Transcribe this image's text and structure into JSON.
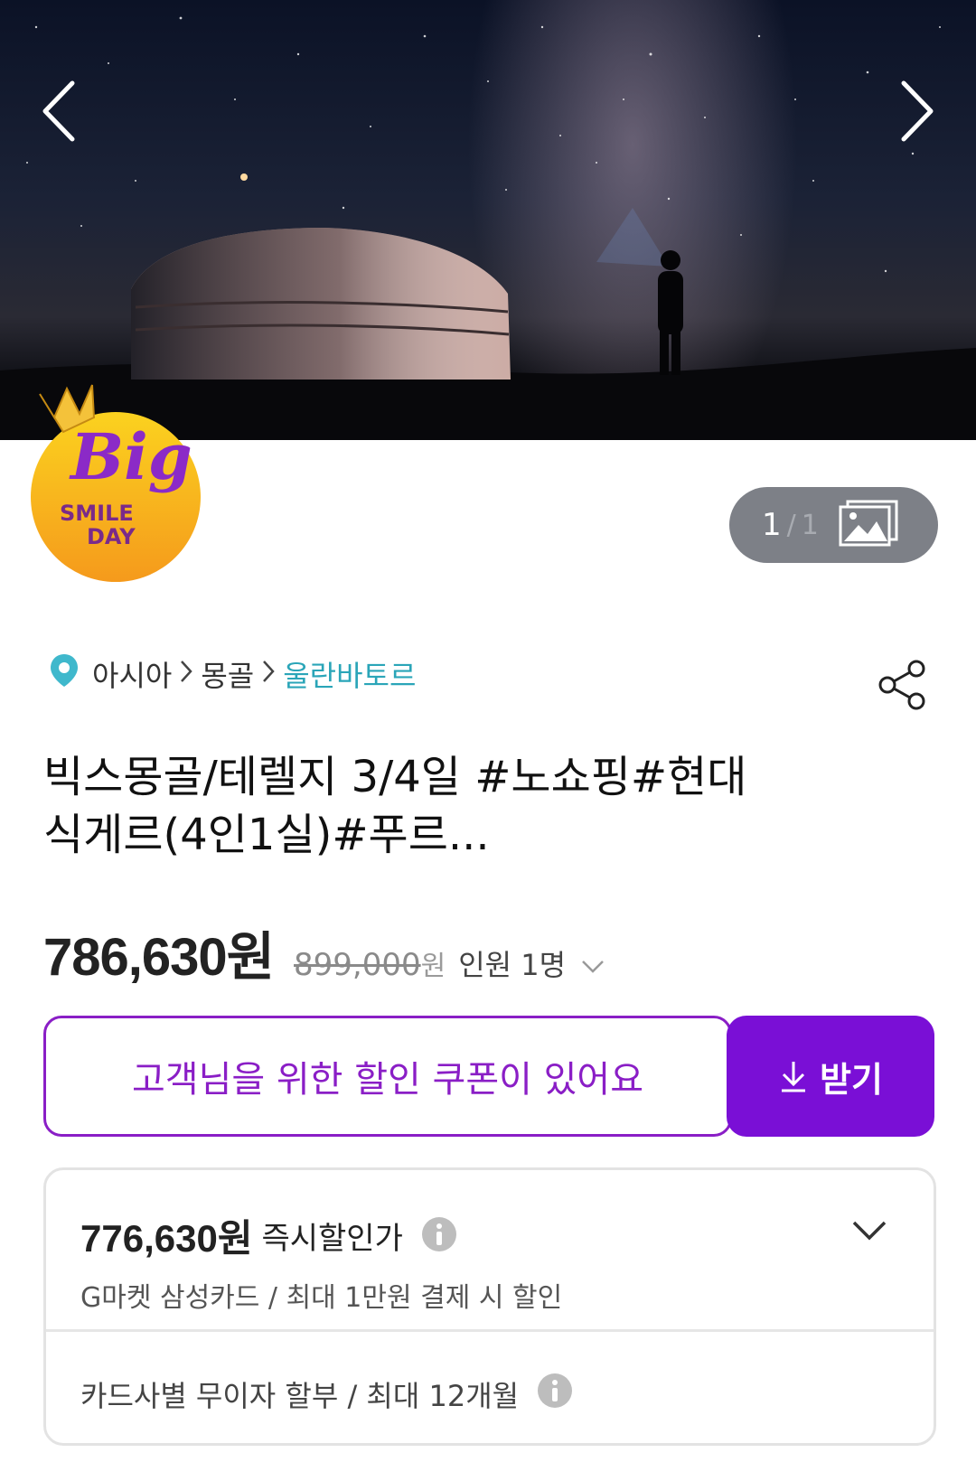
{
  "hero": {
    "image_description_name": "mongolia-ger-night-sky",
    "counter": {
      "current": "1",
      "separator": "/",
      "total": "1"
    }
  },
  "badge": {
    "line1": "Big",
    "line2": "SMILE",
    "line3": "DAY"
  },
  "breadcrumb": {
    "level1": "아시아",
    "level2": "몽골",
    "level3": "울란바토르"
  },
  "product": {
    "title": "빅스몽골/테렐지 3/4일 #노쇼핑#현대식게르(4인1실)#푸르...",
    "price": "786,630원",
    "original_price": "899,000",
    "original_unit": "원",
    "people_label": "인원 1명"
  },
  "coupon": {
    "message": "고객님을 위한 할인 쿠폰이 있어요",
    "button_label": "받기"
  },
  "discount": {
    "price": "776,630원",
    "label": "즉시할인가",
    "sub": "G마켓 삼성카드 / 최대 1만원 결제 시 할인",
    "installment": "카드사별 무이자 할부 / 최대 12개월"
  },
  "colors": {
    "accent": "#7a0fd6",
    "link": "#2aa5b8",
    "badge": "#f9b91a"
  }
}
